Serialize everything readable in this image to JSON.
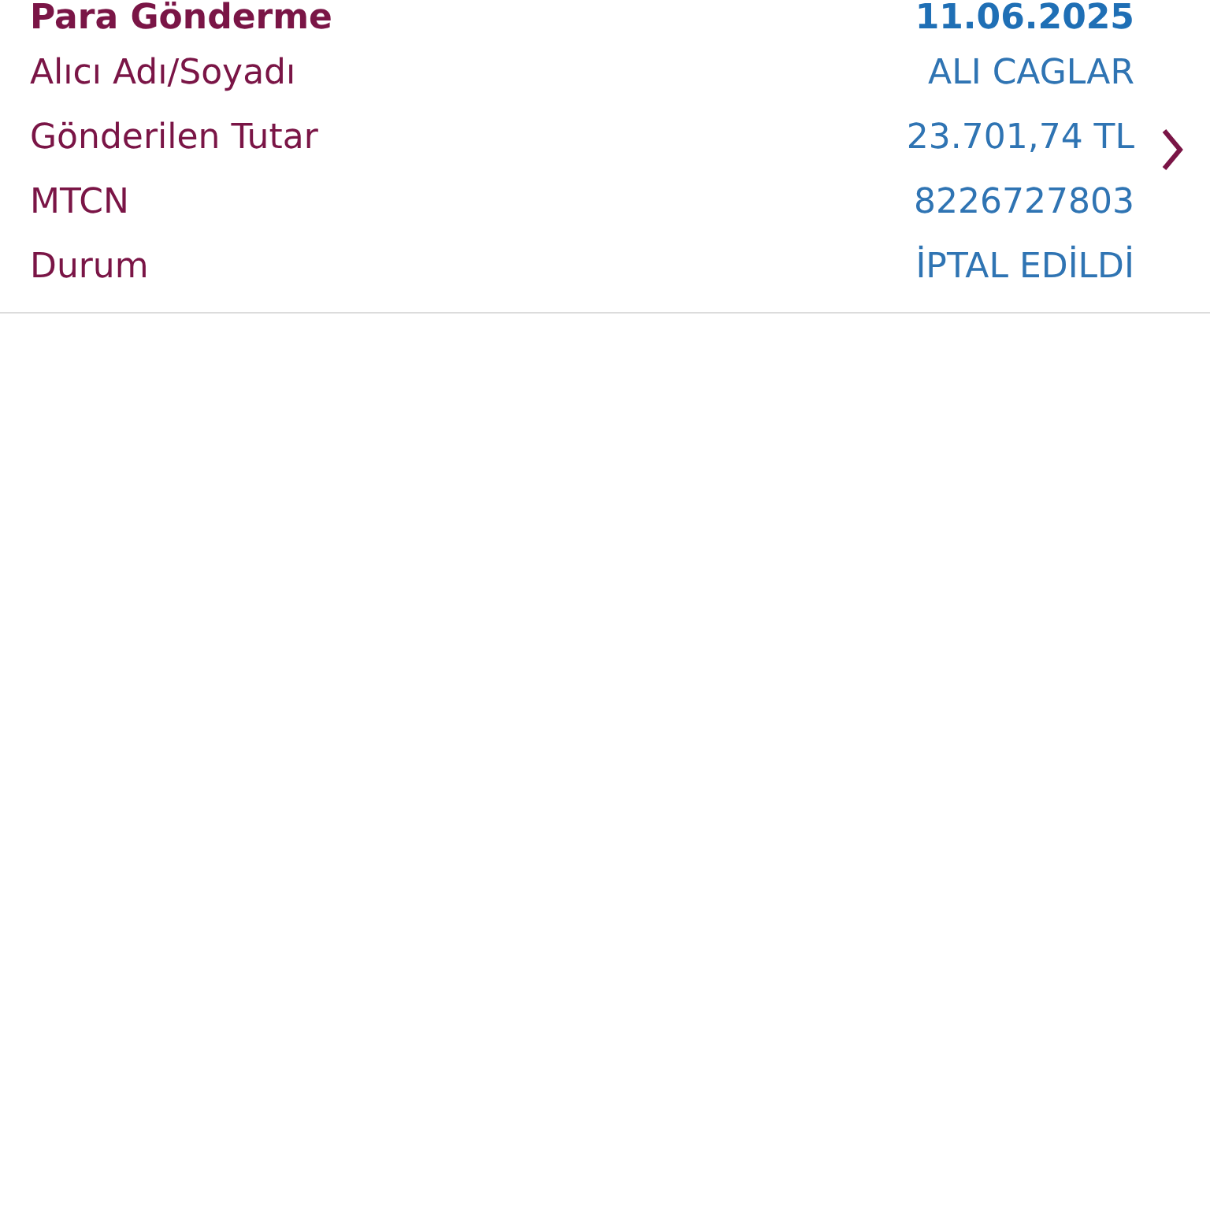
{
  "transaction": {
    "type": "Para Gönderme",
    "date": "11.06.2025",
    "details": [
      {
        "label": "Alıcı Adı/Soyadı",
        "value": "ALI CAGLAR"
      },
      {
        "label": "Gönderilen Tutar",
        "value": "23.701,74 TL"
      },
      {
        "label": "MTCN",
        "value": "8226727803"
      },
      {
        "label": "Durum",
        "value": "İPTAL EDİLDİ"
      }
    ]
  }
}
